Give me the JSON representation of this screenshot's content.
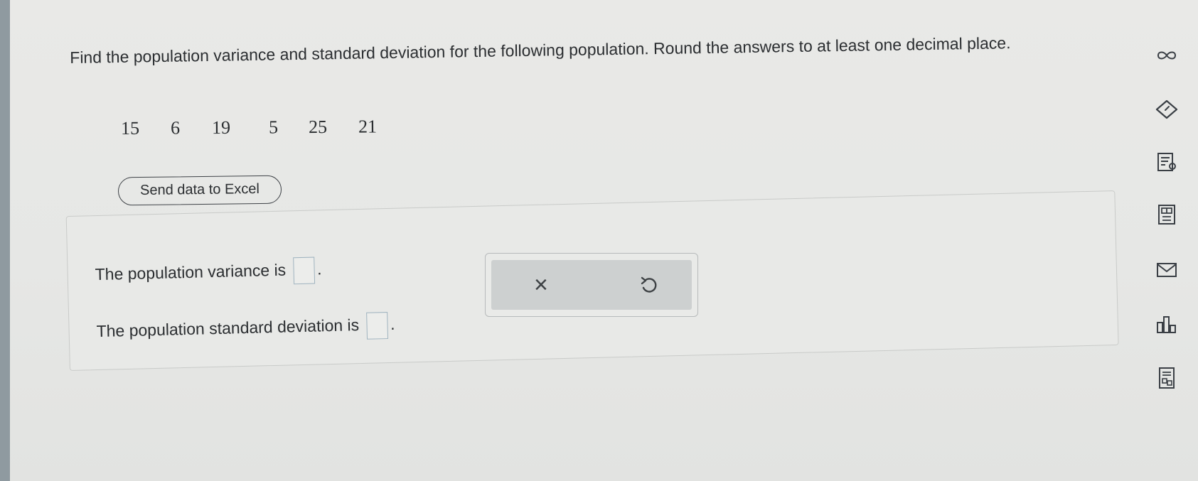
{
  "question": {
    "prompt": "Find the population variance and standard deviation for the following population. Round the answers to at least one decimal place."
  },
  "population": [
    "15",
    "6",
    "19",
    "5",
    "25",
    "21"
  ],
  "excel_button": {
    "label": "Send data to Excel"
  },
  "answers": {
    "variance_label": "The population variance is",
    "stddev_label": "The population standard deviation is",
    "variance_value": "",
    "stddev_value": "",
    "period": "."
  },
  "tools": {
    "clear_glyph": "×"
  },
  "sidebar_icons": [
    "infinity-icon",
    "tag-icon",
    "notes-icon",
    "calculator-icon",
    "mail-icon",
    "bar-chart-icon",
    "worksheet-icon"
  ],
  "colors": {
    "background": "#e6e7e5",
    "text": "#2b2e31",
    "input_border": "#9fb3bf",
    "tool_panel": "#cdd0d0",
    "icon": "#3a3f45"
  }
}
